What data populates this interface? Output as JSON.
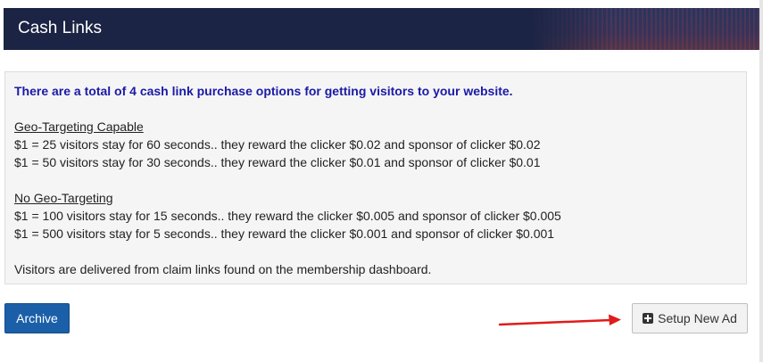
{
  "header": {
    "title": "Cash Links"
  },
  "info": {
    "headline": "There are a total of 4 cash link purchase options for getting visitors to your website.",
    "sections": [
      {
        "title": "Geo-Targeting Capable",
        "lines": [
          "$1 = 25 visitors stay for 60 seconds.. they reward the clicker $0.02 and sponsor of clicker $0.02",
          "$1 = 50 visitors stay for 30 seconds.. they reward the clicker $0.01 and sponsor of clicker $0.01"
        ]
      },
      {
        "title": "No Geo-Targeting",
        "lines": [
          "$1 = 100 visitors stay for 15 seconds.. they reward the clicker $0.005 and sponsor of clicker $0.005",
          "$1 = 500 visitors stay for 5 seconds.. they reward the clicker $0.001 and sponsor of clicker $0.001"
        ]
      }
    ],
    "footer": "Visitors are delivered from claim links found on the membership dashboard."
  },
  "actions": {
    "archive_label": "Archive",
    "setup_label": "Setup New Ad"
  },
  "colors": {
    "header_bg": "#1b2444",
    "headline": "#1a1aa6",
    "archive_bg": "#1a5fa8",
    "arrow": "#e01b1b"
  },
  "icons": {
    "setup": "plus-square-icon",
    "pointer": "red-arrow-icon"
  }
}
